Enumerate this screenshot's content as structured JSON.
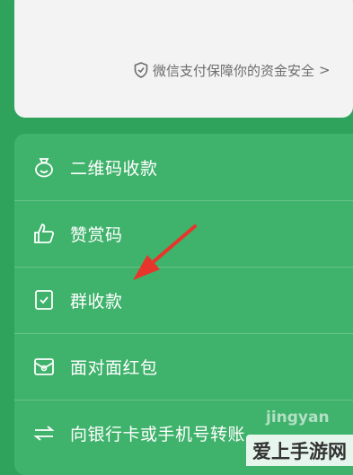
{
  "security": {
    "text": "微信支付保障你的资金安全",
    "chevron": ">"
  },
  "menu": {
    "items": [
      {
        "label": "二维码收款",
        "icon": "qr-money-bag-icon"
      },
      {
        "label": "赞赏码",
        "icon": "thumbs-up-icon"
      },
      {
        "label": "群收款",
        "icon": "group-collection-icon"
      },
      {
        "label": "面对面红包",
        "icon": "red-packet-icon"
      },
      {
        "label": "向银行卡或手机号转账",
        "icon": "transfer-icon"
      }
    ]
  },
  "watermark": {
    "line1": "jingyan",
    "line2": "爱上手游网"
  },
  "colors": {
    "background": "#2fa35c",
    "panel": "#3fb26b",
    "arrow": "#e8352b",
    "card": "#f3f3f3"
  }
}
